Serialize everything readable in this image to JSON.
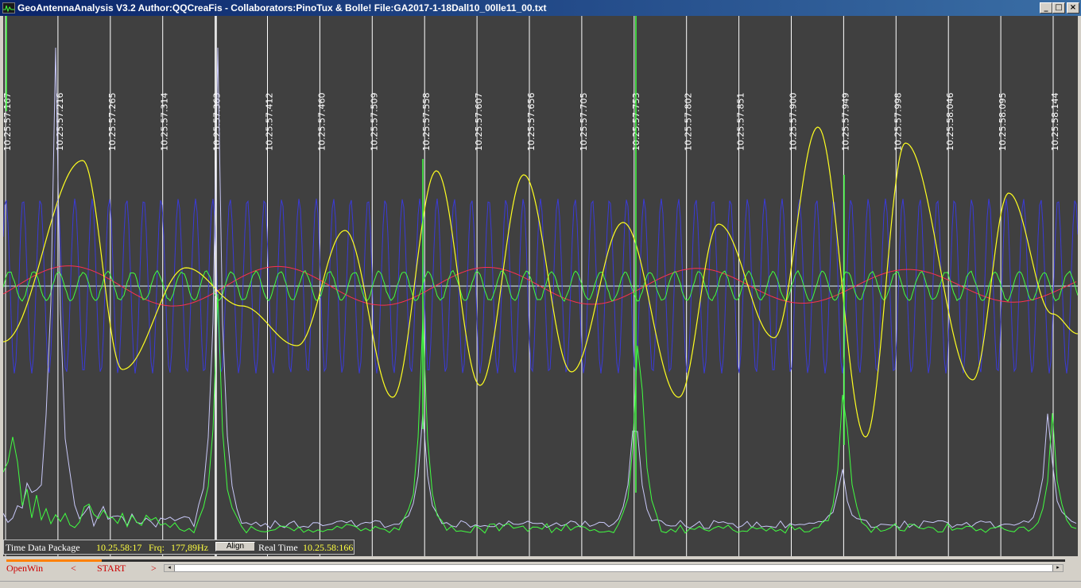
{
  "window": {
    "title": "GeoAntennaAnalysis V3.2 Author:QQCreaFis - Collaborators:PinoTux & Bolle!    File:GA2017-1-18Dall10_00lle11_00.txt",
    "minimize": "_",
    "maximize": "□",
    "close": "×"
  },
  "time_labels": [
    "10.25.57.167",
    "10.25.57.216",
    "10.25.57.265",
    "10.25.57.314",
    "10.25.57.363",
    "10.25.57.412",
    "10.25.57.460",
    "10.25.57.509",
    "10.25.57.558",
    "10.25.57.607",
    "10.25.57.656",
    "10.25.57.705",
    "10.25.57.753",
    "10.25.57.802",
    "10.25.57.851",
    "10.25.57.900",
    "10.25.57.949",
    "10.25.57.998",
    "10.25.58.046",
    "10.25.58.095",
    "10.25.58.144"
  ],
  "info": {
    "time_data_label": "Time Data Package",
    "time_data_value": "10.25.58:17",
    "freq_label": "Frq:",
    "freq_value": "177,89Hz",
    "align_label": "Align",
    "real_time_label": "Real Time",
    "real_time_value": "10.25.58:166"
  },
  "controls": {
    "open_win": "OpenWin",
    "prev": "<",
    "start": "START",
    "next": ">",
    "scroll_left": "◂",
    "scroll_right": "▸"
  },
  "progress": 0.09,
  "colors": {
    "plot_bg": "#404040",
    "blue": "#3a3ad8",
    "green": "#40ff40",
    "yellow": "#ffff20",
    "red": "#ff3050",
    "lavender": "#c8c8f8",
    "baseline": "#d8f0ff",
    "marker": "#ffffff",
    "value_text": "#ffff40",
    "control_text": "#cc0000"
  }
}
